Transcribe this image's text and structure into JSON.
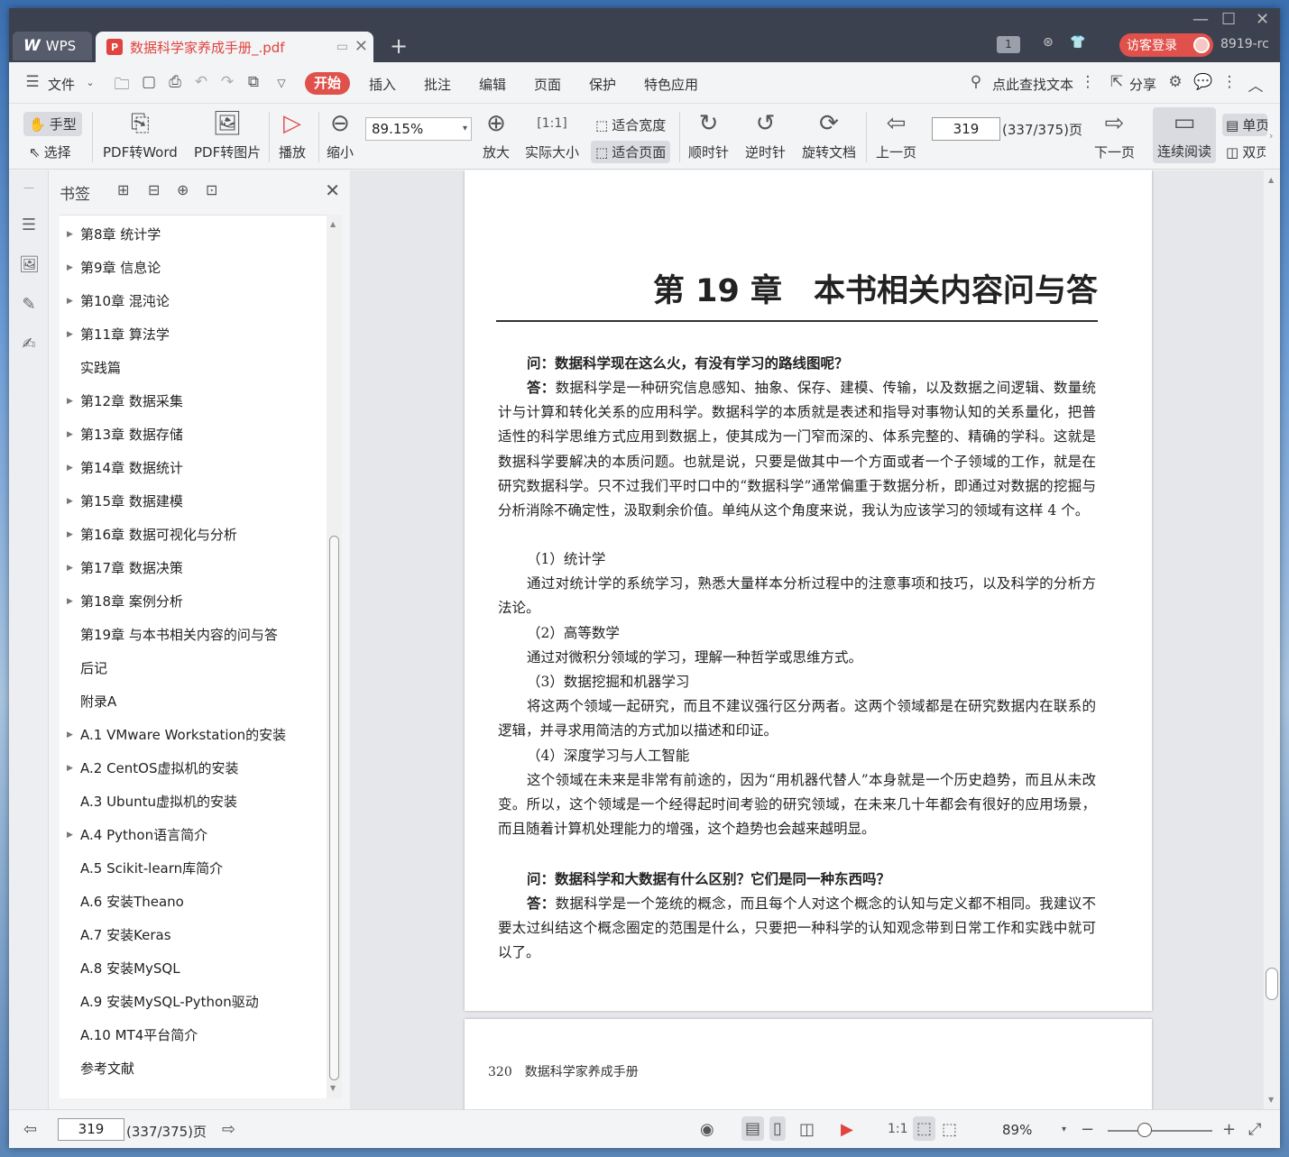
{
  "titlebar": {
    "app_tab": "WPS",
    "doc_tab": "数据科学家养成手册_.pdf",
    "badge": "1",
    "login_button": "访客登录",
    "account": "8919-rc"
  },
  "menubar": {
    "file": "文件",
    "tabs": [
      "开始",
      "插入",
      "批注",
      "编辑",
      "页面",
      "保护",
      "特色应用"
    ],
    "search": "点此查找文本",
    "share": "分享"
  },
  "ribbon": {
    "hand": "手型",
    "select": "选择",
    "pdf_to_word": "PDF转Word",
    "pdf_to_image": "PDF转图片",
    "play": "播放",
    "zoom_out": "缩小",
    "zoom_value": "89.15%",
    "zoom_in": "放大",
    "actual_size": "实际大小",
    "fit_width": "适合宽度",
    "fit_page": "适合页面",
    "rotate_cw": "顺时针",
    "rotate_ccw": "逆时针",
    "rotate_doc": "旋转文档",
    "prev_page": "上一页",
    "page_number": "319",
    "page_info": "(337/375)页",
    "next_page": "下一页",
    "continuous": "连续阅读",
    "single": "单页",
    "double": "双页"
  },
  "bookmarks": {
    "title": "书签",
    "items": [
      {
        "label": "第8章 统计学",
        "expandable": true
      },
      {
        "label": "第9章 信息论",
        "expandable": true
      },
      {
        "label": "第10章 混沌论",
        "expandable": true
      },
      {
        "label": "第11章 算法学",
        "expandable": true
      },
      {
        "label": "实践篇",
        "expandable": false
      },
      {
        "label": "第12章 数据采集",
        "expandable": true
      },
      {
        "label": "第13章 数据存储",
        "expandable": true
      },
      {
        "label": "第14章 数据统计",
        "expandable": true
      },
      {
        "label": "第15章 数据建模",
        "expandable": true
      },
      {
        "label": "第16章 数据可视化与分析",
        "expandable": true
      },
      {
        "label": "第17章 数据决策",
        "expandable": true
      },
      {
        "label": "第18章 案例分析",
        "expandable": true
      },
      {
        "label": "第19章 与本书相关内容的问与答",
        "expandable": false
      },
      {
        "label": "后记",
        "expandable": false
      },
      {
        "label": "附录A",
        "expandable": false
      },
      {
        "label": "A.1 VMware Workstation的安装",
        "expandable": true
      },
      {
        "label": "A.2 CentOS虚拟机的安装",
        "expandable": true
      },
      {
        "label": "A.3 Ubuntu虚拟机的安装",
        "expandable": false
      },
      {
        "label": "A.4 Python语言简介",
        "expandable": true
      },
      {
        "label": "A.5 Scikit-learn库简介",
        "expandable": false
      },
      {
        "label": "A.6 安装Theano",
        "expandable": false
      },
      {
        "label": "A.7 安装Keras",
        "expandable": false
      },
      {
        "label": "A.8 安装MySQL",
        "expandable": false
      },
      {
        "label": "A.9 安装MySQL-Python驱动",
        "expandable": false
      },
      {
        "label": "A.10 MT4平台简介",
        "expandable": false
      },
      {
        "label": "参考文献",
        "expandable": false
      }
    ]
  },
  "document": {
    "chapter_title": "第 19 章　本书相关内容问与答",
    "q1": "问：数据科学现在这么火，有没有学习的路线图呢？",
    "a1_label": "答：",
    "a1": "数据科学是一种研究信息感知、抽象、保存、建模、传输，以及数据之间逻辑、数量统计与计算和转化关系的应用科学。数据科学的本质就是表述和指导对事物认知的关系量化，把普适性的科学思维方式应用到数据上，使其成为一门窄而深的、体系完整的、精确的学科。这就是数据科学要解决的本质问题。也就是说，只要是做其中一个方面或者一个子领域的工作，就是在研究数据科学。只不过我们平时口中的“数据科学”通常偏重于数据分析，即通过对数据的挖掘与分析消除不确定性，汲取剩余价值。单纯从这个角度来说，我认为应该学习的领域有这样 4 个。",
    "s1": "（1）统计学",
    "p1": "通过对统计学的系统学习，熟悉大量样本分析过程中的注意事项和技巧，以及科学的分析方法论。",
    "s2": "（2）高等数学",
    "p2": "通过对微积分领域的学习，理解一种哲学或思维方式。",
    "s3": "（3）数据挖掘和机器学习",
    "p3": "将这两个领域一起研究，而且不建议强行区分两者。这两个领域都是在研究数据内在联系的逻辑，并寻求用简洁的方式加以描述和印证。",
    "s4": "（4）深度学习与人工智能",
    "p4": "这个领域在未来是非常有前途的，因为“用机器代替人”本身就是一个历史趋势，而且从未改变。所以，这个领域是一个经得起时间考验的研究领域，在未来几十年都会有很好的应用场景，而且随着计算机处理能力的增强，这个趋势也会越来越明显。",
    "q2": "问：数据科学和大数据有什么区别？它们是同一种东西吗？",
    "a2_label": "答：",
    "a2": "数据科学是一个笼统的概念，而且每个人对这个概念的认知与定义都不相同。我建议不要太过纠结这个概念圈定的范围是什么，只要把一种科学的认知观念带到日常工作和实践中就可以了。",
    "next_page_header": "320　数据科学家养成手册"
  },
  "statusbar": {
    "page_number": "319",
    "page_info": "(337/375)页",
    "zoom": "89%",
    "zoom_fraction": 0.35
  }
}
